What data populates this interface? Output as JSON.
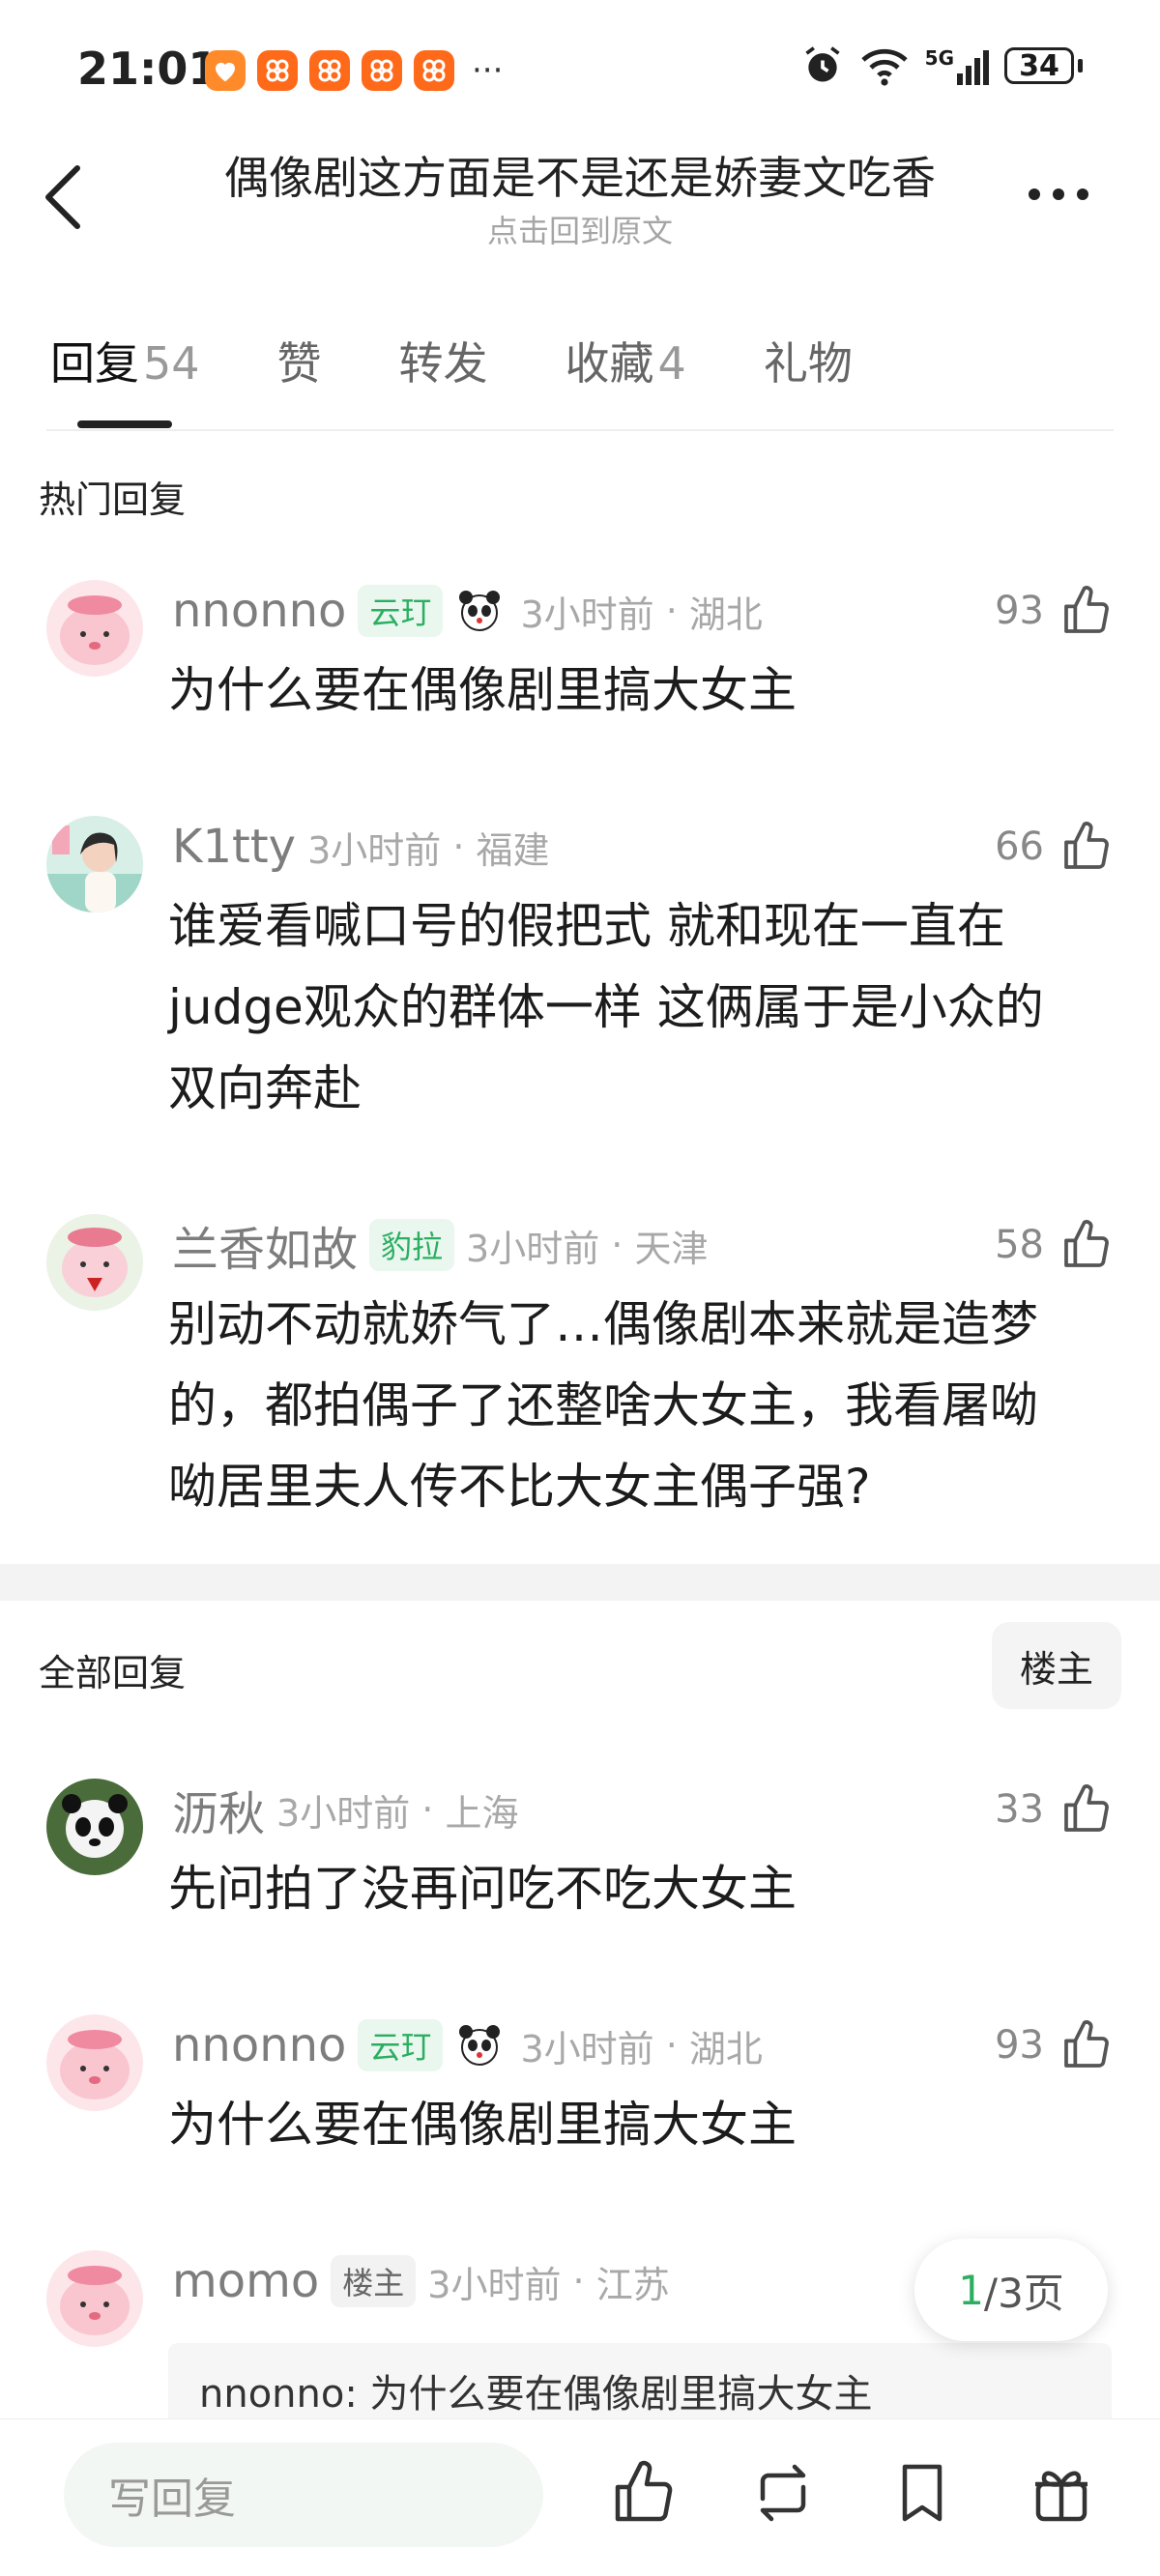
{
  "status": {
    "time": "21:01",
    "battery": "34",
    "more": "···",
    "signal": "5G"
  },
  "header": {
    "title": "偶像剧这方面是不是还是娇妻文吃香",
    "subtitle": "点击回到原文"
  },
  "tabs": [
    {
      "label": "回复",
      "count": "54"
    },
    {
      "label": "赞",
      "count": ""
    },
    {
      "label": "转发",
      "count": ""
    },
    {
      "label": "收藏",
      "count": "4"
    },
    {
      "label": "礼物",
      "count": ""
    }
  ],
  "sections": {
    "hot": "热门回复",
    "all": "全部回复",
    "owner_filter": "楼主"
  },
  "hot_comments": [
    {
      "user": "nnonno",
      "badge": "云玎",
      "time": "3小时前",
      "location": "湖北",
      "likes": "93",
      "text": "为什么要在偶像剧里搞大女主"
    },
    {
      "user": "K1tty",
      "badge": "",
      "time": "3小时前",
      "location": "福建",
      "likes": "66",
      "text": "谁爱看喊口号的假把式 就和现在一直在judge观众的群体一样 这俩属于是小众的双向奔赴"
    },
    {
      "user": "兰香如故",
      "badge": "豹拉",
      "time": "3小时前",
      "location": "天津",
      "likes": "58",
      "text": "别动不动就娇气了…偶像剧本来就是造梦的，都拍偶子了还整啥大女主，我看屠呦呦居里夫人传不比大女主偶子强?"
    }
  ],
  "all_comments": [
    {
      "user": "沥秋",
      "badge": "",
      "time": "3小时前",
      "location": "上海",
      "likes": "33",
      "text": "先问拍了没再问吃不吃大女主"
    },
    {
      "user": "nnonno",
      "badge": "云玎",
      "time": "3小时前",
      "location": "湖北",
      "likes": "93",
      "text": "为什么要在偶像剧里搞大女主"
    },
    {
      "user": "momo",
      "badge": "楼主",
      "time": "3小时前",
      "location": "江苏",
      "quote": "nnonno: 为什么要在偶像剧里搞大女主"
    }
  ],
  "pager": {
    "current": "1",
    "total": "/3页"
  },
  "bottom": {
    "reply_placeholder": "写回复"
  },
  "colors": {
    "accent": "#2cae61",
    "text": "#1c1c1c",
    "meta": "#a8a8a8"
  }
}
